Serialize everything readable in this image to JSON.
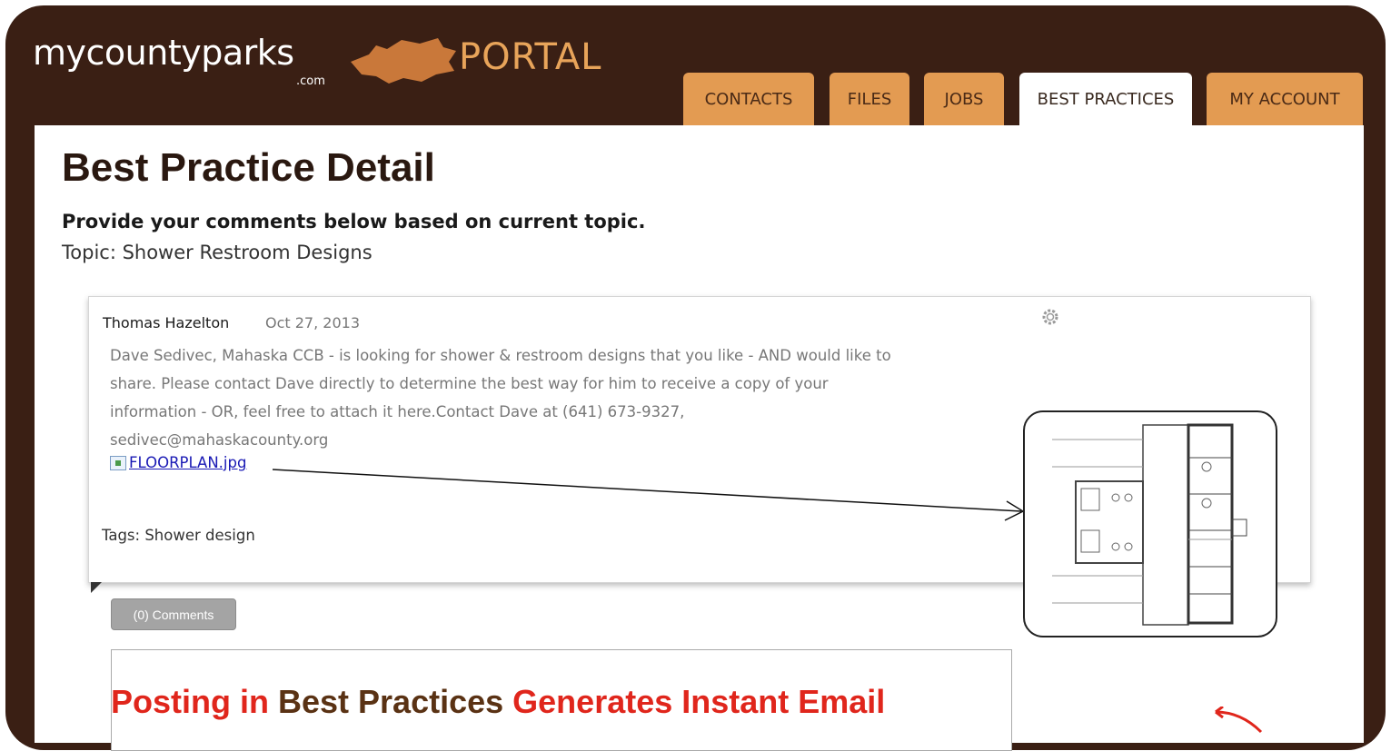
{
  "header": {
    "logo_text": "mycountyparks",
    "logo_suffix": ".com",
    "portal_text": "PORTAL",
    "tabs": [
      {
        "label": "CONTACTS",
        "active": false
      },
      {
        "label": "FILES",
        "active": false
      },
      {
        "label": "JOBS",
        "active": false
      },
      {
        "label": "BEST PRACTICES",
        "active": true
      },
      {
        "label": "MY ACCOUNT",
        "active": false
      }
    ]
  },
  "page": {
    "title": "Best Practice Detail",
    "subtitle": "Provide your comments below based on current topic.",
    "topic": "Topic: Shower Restroom Designs"
  },
  "post": {
    "author": "Thomas Hazelton",
    "date": "Oct 27, 2013",
    "body_lines": [
      "Dave Sedivec, Mahaska CCB - is looking for shower & restroom designs that you like - AND would like to",
      "share. Please contact Dave directly to determine the best way for him to receive a copy of your",
      "information - OR, feel free to attach it here.Contact Dave at (641) 673-9327,",
      "sedivec@mahaskacounty.org"
    ],
    "attachment": "FLOORPLAN.jpg",
    "tags": "Tags: Shower design"
  },
  "comments": {
    "button_label": "(0) Comments"
  },
  "callout": {
    "part1": "Posting in ",
    "part2": "Best Practices",
    "part3": " Generates Instant Email"
  },
  "colors": {
    "frame": "#3a1f14",
    "tab": "#e39b52",
    "portal": "#e8a45a",
    "callout_red": "#e0261c",
    "callout_brown": "#5a3214",
    "link": "#1a1ab5"
  }
}
